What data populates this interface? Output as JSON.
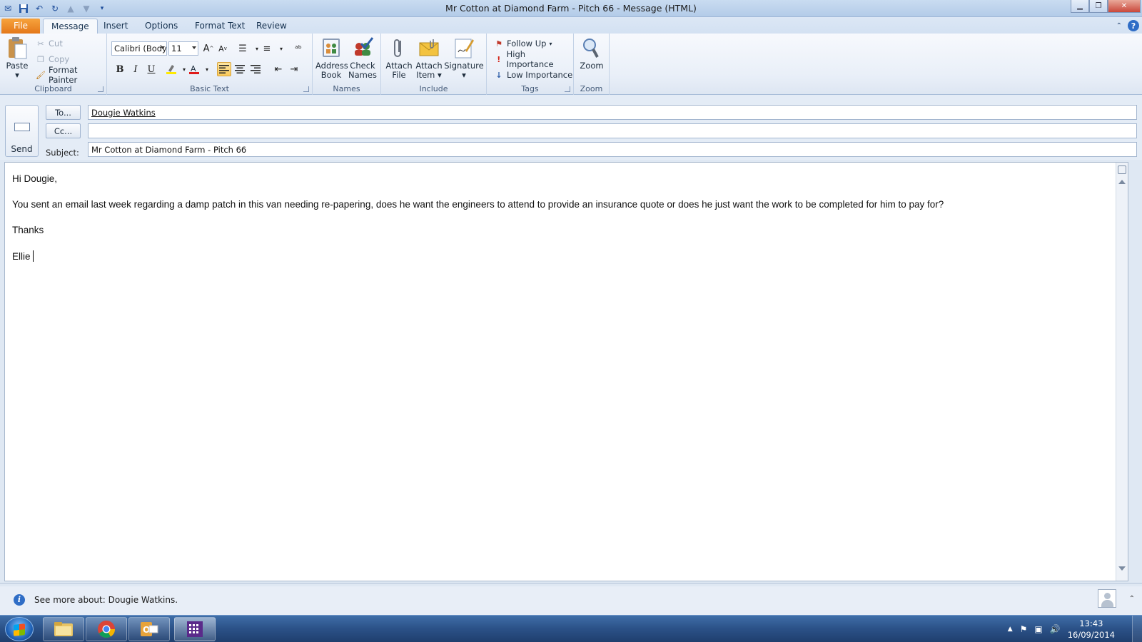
{
  "window": {
    "title": "Mr Cotton at Diamond Farm - Pitch 66  -  Message (HTML)",
    "minimize": "▁",
    "maximize": "❐",
    "close": "✕"
  },
  "ribbon_tabs": [
    "File",
    "Message",
    "Insert",
    "Options",
    "Format Text",
    "Review"
  ],
  "ribbon": {
    "clipboard": {
      "label": "Clipboard",
      "paste": "Paste",
      "cut": "Cut",
      "copy": "Copy",
      "format_painter": "Format Painter"
    },
    "basic_text": {
      "label": "Basic Text",
      "font": "Calibri (Body)",
      "size": "11",
      "bold": "B",
      "italic": "I",
      "underline": "U"
    },
    "names": {
      "label": "Names",
      "address_book_1": "Address",
      "address_book_2": "Book",
      "check_names_1": "Check",
      "check_names_2": "Names"
    },
    "include": {
      "label": "Include",
      "attach_file_1": "Attach",
      "attach_file_2": "File",
      "attach_item_1": "Attach",
      "attach_item_2": "Item",
      "signature": "Signature"
    },
    "tags": {
      "label": "Tags",
      "follow_up": "Follow Up",
      "high_importance": "High Importance",
      "low_importance": "Low Importance"
    },
    "zoom": {
      "label": "Zoom",
      "zoom": "Zoom"
    }
  },
  "compose": {
    "send": "Send",
    "to_button": "To...",
    "cc_button": "Cc...",
    "subject_label": "Subject:",
    "to_value": "Dougie Watkins",
    "cc_value": "",
    "subject_value": "Mr Cotton at Diamond Farm - Pitch 66"
  },
  "body": {
    "greeting": "Hi Dougie,",
    "paragraph": "You sent an email last week regarding a damp patch in this van needing re-papering, does he want the engineers to attend to provide an insurance quote or does he just want the work to be completed for him to pay for?",
    "thanks": "Thanks",
    "signature": "Ellie"
  },
  "people_pane": {
    "text": "See more about: Dougie Watkins."
  },
  "taskbar": {
    "time": "13:43",
    "date": "16/09/2014"
  }
}
